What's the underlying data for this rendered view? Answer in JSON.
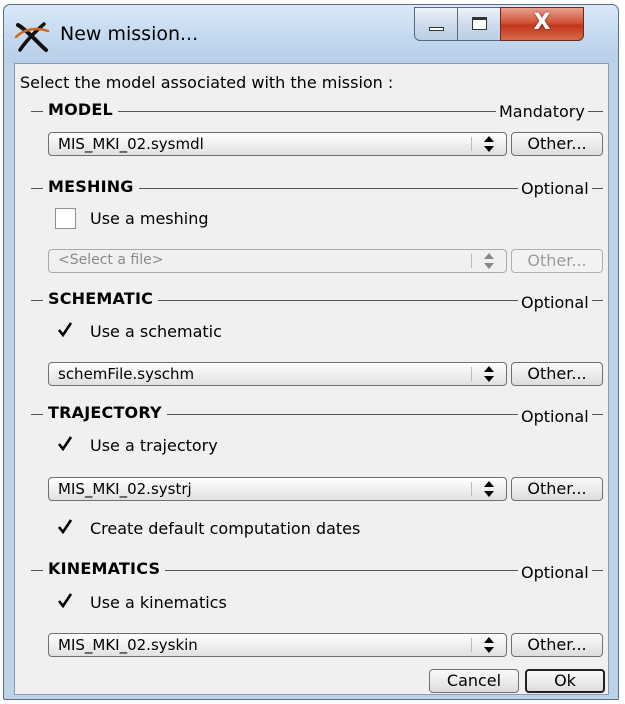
{
  "window": {
    "title": "New mission...",
    "controls": [
      "minimize-icon",
      "maximize-icon",
      "close-icon"
    ],
    "close_glyph": "X"
  },
  "prompt": "Select the model associated with the mission :",
  "sections": {
    "model": {
      "title": "MODEL",
      "requirement": "Mandatory",
      "file": "MIS_MKI_02.sysmdl",
      "other_label": "Other..."
    },
    "meshing": {
      "title": "MESHING",
      "requirement": "Optional",
      "checkbox_label": "Use a meshing",
      "checked": false,
      "file": "<Select a file>",
      "other_label": "Other..."
    },
    "schematic": {
      "title": "SCHEMATIC",
      "requirement": "Optional",
      "checkbox_label": "Use a schematic",
      "checked": true,
      "file": "schemFile.syschm",
      "other_label": "Other..."
    },
    "trajectory": {
      "title": "TRAJECTORY",
      "requirement": "Optional",
      "checkbox_label": "Use a trajectory",
      "checked": true,
      "file": "MIS_MKI_02.systrj",
      "other_label": "Other...",
      "dates_label": "Create default computation dates",
      "dates_checked": true
    },
    "kinematics": {
      "title": "KINEMATICS",
      "requirement": "Optional",
      "checkbox_label": "Use a kinematics",
      "checked": true,
      "file": "MIS_MKI_02.syskin",
      "other_label": "Other..."
    }
  },
  "buttons": {
    "cancel": "Cancel",
    "ok": "Ok"
  },
  "colors": {
    "title_bar": "#c2d8ee",
    "close_button": "#c2361b",
    "dialog_background": "#f0f0f0"
  }
}
